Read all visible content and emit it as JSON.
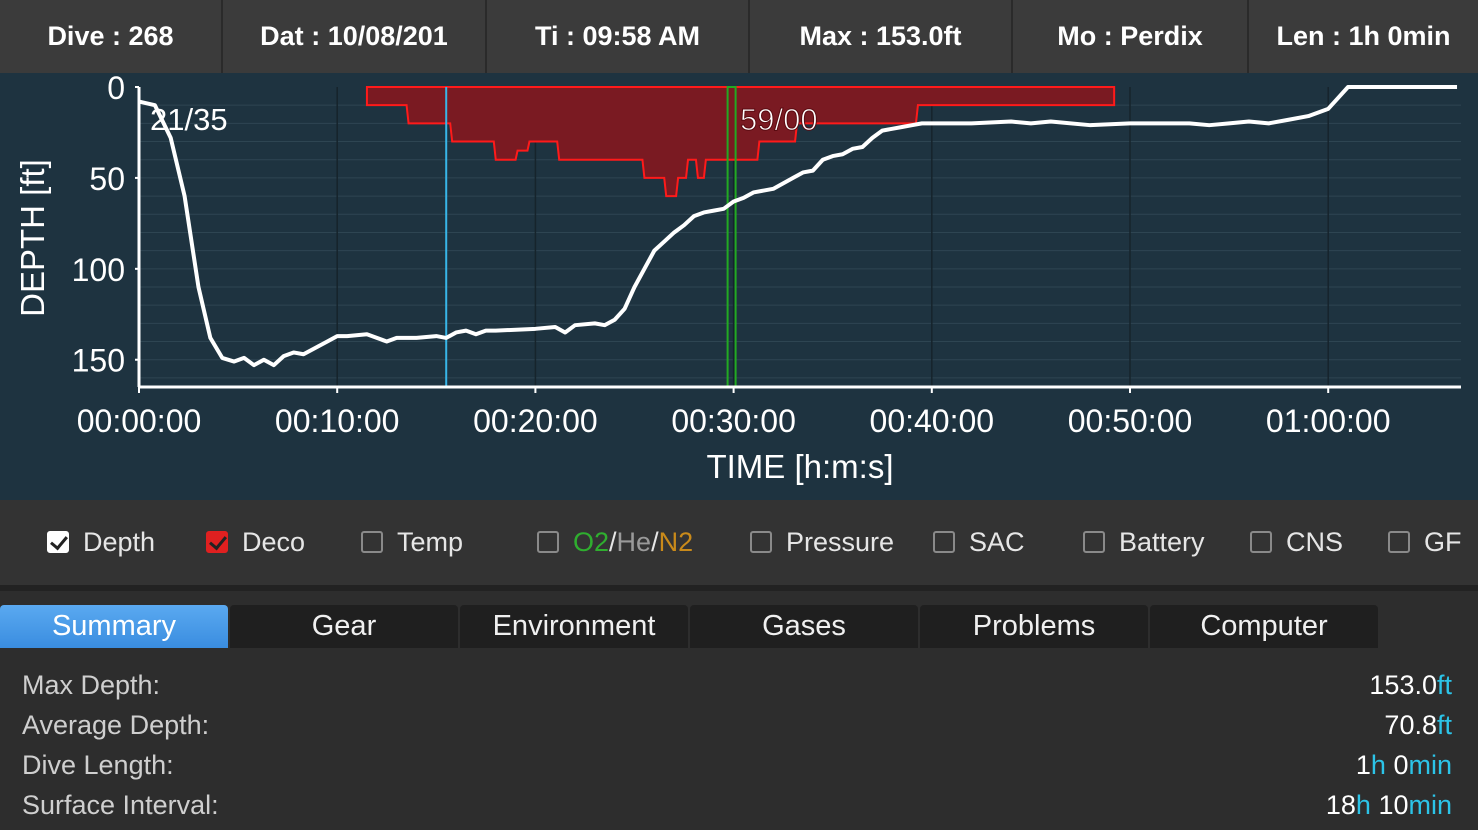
{
  "header": [
    {
      "key": "Dive",
      "value": "268"
    },
    {
      "key": "Dat",
      "value": "10/08/201"
    },
    {
      "key": "Ti",
      "value": "09:58 AM"
    },
    {
      "key": "Max",
      "value": "153.0ft"
    },
    {
      "key": "Mo",
      "value": "Perdix"
    },
    {
      "key": "Len",
      "value": "1h 0min"
    }
  ],
  "chart_data": {
    "type": "line",
    "xlabel": "TIME [h:m:s]",
    "ylabel": "DEPTH [ft]",
    "x_ticks": [
      "00:00:00",
      "00:10:00",
      "00:20:00",
      "00:30:00",
      "00:40:00",
      "00:50:00",
      "01:00:00"
    ],
    "y_ticks": [
      "0",
      "50",
      "100",
      "150"
    ],
    "xlim_min": [
      0,
      66.7
    ],
    "ylim_ft": [
      0,
      165
    ],
    "gas_label": "21/35",
    "cursor_label": "59/00",
    "markers_min": {
      "gas_switch": 15.5,
      "cursor": 30
    },
    "colors": {
      "depth": "#ffffff",
      "deco_fill": "#7a1a22",
      "deco_line": "#ff1a1a",
      "gas_switch": "#38b6e8",
      "cursor": "#22aa22",
      "bg": "#1e3340"
    },
    "series": [
      {
        "kind": "depth",
        "t": [
          0,
          0.8,
          1.6,
          2.3,
          3,
          3.6,
          4.2,
          4.8,
          5.3,
          5.8,
          6.3,
          6.8,
          7.3,
          7.8,
          8.3,
          9.5,
          10,
          10.5,
          11.5,
          12,
          12.5,
          13,
          14,
          15,
          15.5,
          16,
          16.5,
          17,
          17.5,
          18,
          20,
          21,
          21.5,
          22,
          23,
          23.5,
          24,
          24.5,
          25,
          25.5,
          26,
          26.5,
          27,
          27.5,
          28,
          28.5,
          29,
          29.5,
          30,
          30.5,
          31,
          32,
          33,
          33.5,
          34,
          34.5,
          35,
          35.5,
          36,
          36.5,
          37,
          37.5,
          38,
          38.5,
          39,
          39.5,
          40,
          42,
          44,
          45,
          46,
          48,
          50,
          52,
          53,
          54,
          55,
          56,
          57,
          58,
          59,
          60,
          60.5,
          61,
          66.5
        ],
        "depth": [
          8,
          10,
          28,
          60,
          110,
          138,
          149,
          151,
          149,
          153,
          150,
          153,
          148,
          146,
          147,
          140,
          137,
          137,
          136,
          138,
          140,
          138,
          138,
          137,
          138,
          135,
          134,
          136,
          134,
          134,
          133,
          132,
          135,
          131,
          130,
          131,
          128,
          122,
          110,
          100,
          90,
          85,
          80,
          76,
          71,
          69,
          68,
          67,
          63,
          61,
          58,
          56,
          50,
          47,
          46,
          40,
          38,
          37,
          34,
          33,
          28,
          24,
          23,
          22,
          21,
          20,
          20,
          20,
          19,
          20,
          19,
          21,
          20,
          20,
          20,
          21,
          20,
          19,
          20,
          18,
          16,
          12,
          6,
          0,
          0
        ]
      },
      {
        "kind": "deco_ceiling",
        "t": [
          11.5,
          13.5,
          13.6,
          15.7,
          15.8,
          17.9,
          18,
          19,
          19.1,
          19.6,
          19.7,
          21.1,
          21.2,
          25.4,
          25.5,
          26.5,
          26.6,
          27.1,
          27.2,
          27.6,
          27.7,
          28.1,
          28.2,
          28.5,
          28.6,
          29,
          29.1,
          31.2,
          31.3,
          33.1,
          33.2,
          39.2,
          39.3,
          49.2
        ],
        "ceiling": [
          10,
          10,
          20,
          20,
          30,
          30,
          40,
          40,
          35,
          35,
          30,
          30,
          40,
          40,
          50,
          50,
          60,
          60,
          50,
          50,
          40,
          40,
          50,
          50,
          40,
          40,
          40,
          40,
          30,
          30,
          20,
          20,
          10,
          10
        ]
      }
    ]
  },
  "toggles": [
    {
      "label": "Depth",
      "state": "checked-white"
    },
    {
      "label": "Deco",
      "state": "checked-red"
    },
    {
      "label": "Temp",
      "state": "unchecked"
    },
    {
      "label_parts": [
        "O2",
        "/",
        "He",
        "/",
        "N2"
      ],
      "part_colors": [
        "#2fae2f",
        "#e6e6e6",
        "#9a9a9a",
        "#e6e6e6",
        "#c98a1a"
      ],
      "state": "unchecked"
    },
    {
      "label": "Pressure",
      "state": "unchecked"
    },
    {
      "label": "SAC",
      "state": "unchecked"
    },
    {
      "label": "Battery",
      "state": "unchecked"
    },
    {
      "label": "CNS",
      "state": "unchecked"
    },
    {
      "label": "GF",
      "state": "unchecked"
    }
  ],
  "tabs": [
    "Summary",
    "Gear",
    "Environment",
    "Gases",
    "Problems",
    "Computer"
  ],
  "active_tab": "Summary",
  "summary": [
    {
      "label": "Max Depth:",
      "value": [
        [
          "153.0",
          ""
        ],
        [
          "ft",
          "unit"
        ]
      ]
    },
    {
      "label": "Average Depth:",
      "value": [
        [
          "70.8",
          ""
        ],
        [
          "ft",
          "unit"
        ]
      ]
    },
    {
      "label": "Dive Length:",
      "value": [
        [
          "1",
          ""
        ],
        [
          "h",
          "unit"
        ],
        [
          " 0",
          ""
        ],
        [
          "min",
          "unit"
        ]
      ]
    },
    {
      "label": "Surface Interval:",
      "value": [
        [
          "18",
          ""
        ],
        [
          "h",
          "unit"
        ],
        [
          " 10",
          ""
        ],
        [
          "min",
          "unit"
        ]
      ]
    }
  ]
}
